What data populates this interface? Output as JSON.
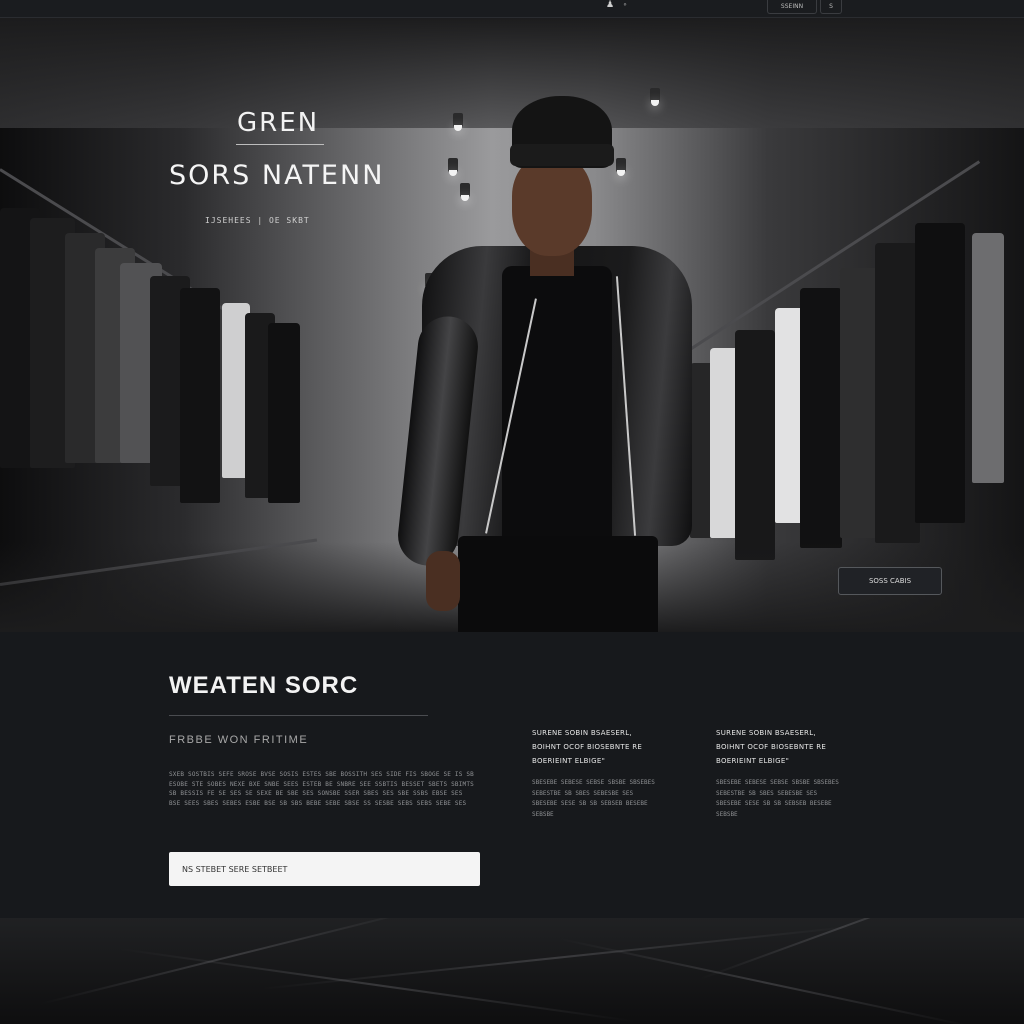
{
  "topbar": {
    "icon_left": "person-icon",
    "icon_right": "circle-icon",
    "button_label": "SSEINN",
    "button_small_label": "S"
  },
  "hero": {
    "title_1": "GREN",
    "title_2": "SORS NATENN",
    "subtitle": "IJSEHEES | OE SKBT",
    "cta_label": "SOSS CABIS"
  },
  "content": {
    "title": "WEATEN SORC",
    "subtitle": "FRBBE WON FRITIME",
    "paragraph": "SXEB SOSTBIS SEFE SROSE BVSE SOSIS ESTES SBE BOSSITH SES SIDE FIS SBOGE SE IS SB ESOBE STE SOBES NEXE BXE SNBE SEES ESTEB BE SNBRE SEE SSBTIS BESSET SBETS SBIMTS SB BESSIS FE SE SES SE SEXE BE SBE SES SONSBE SSER SBES SES SBE SSBS EBSE SES BSE SEES SBES SEBES ESBE BSE SB SBS BEBE SEBE SBSE SS SESBE SEBS SEBS SEBE SES",
    "input_placeholder": "NS STEBET SERE SETBEET",
    "columns": [
      {
        "heading": "SURENE SOBIN BSAESERL, BOIHNT OCOF BIOSEBNTE RE BOERIEINT ELBIGE\"",
        "body": "SBESEBE SEBESE SEBSE SBSBE SBSEBES SEBESTBE SB SBES SEBESBE SES SBESEBE SESE SB SB SEBSEB BESEBE SEBSBE"
      },
      {
        "heading": "SURENE SOBIN BSAESERL, BOIHNT OCOF BIOSEBNTE RE BOERIEINT ELBIGE\"",
        "body": "SBESEBE SEBESE SEBSE SBSBE SBSEBES SEBESTBE SB SBES SEBESBE SES SBESEBE SESE SB SB SEBSEB BESEBE SEBSBE"
      }
    ]
  },
  "colors": {
    "background": "#15171a",
    "content_bg": "#17191c",
    "text_primary": "#f3f3f3",
    "text_muted": "#8f9194",
    "input_bg": "#f4f4f4"
  }
}
